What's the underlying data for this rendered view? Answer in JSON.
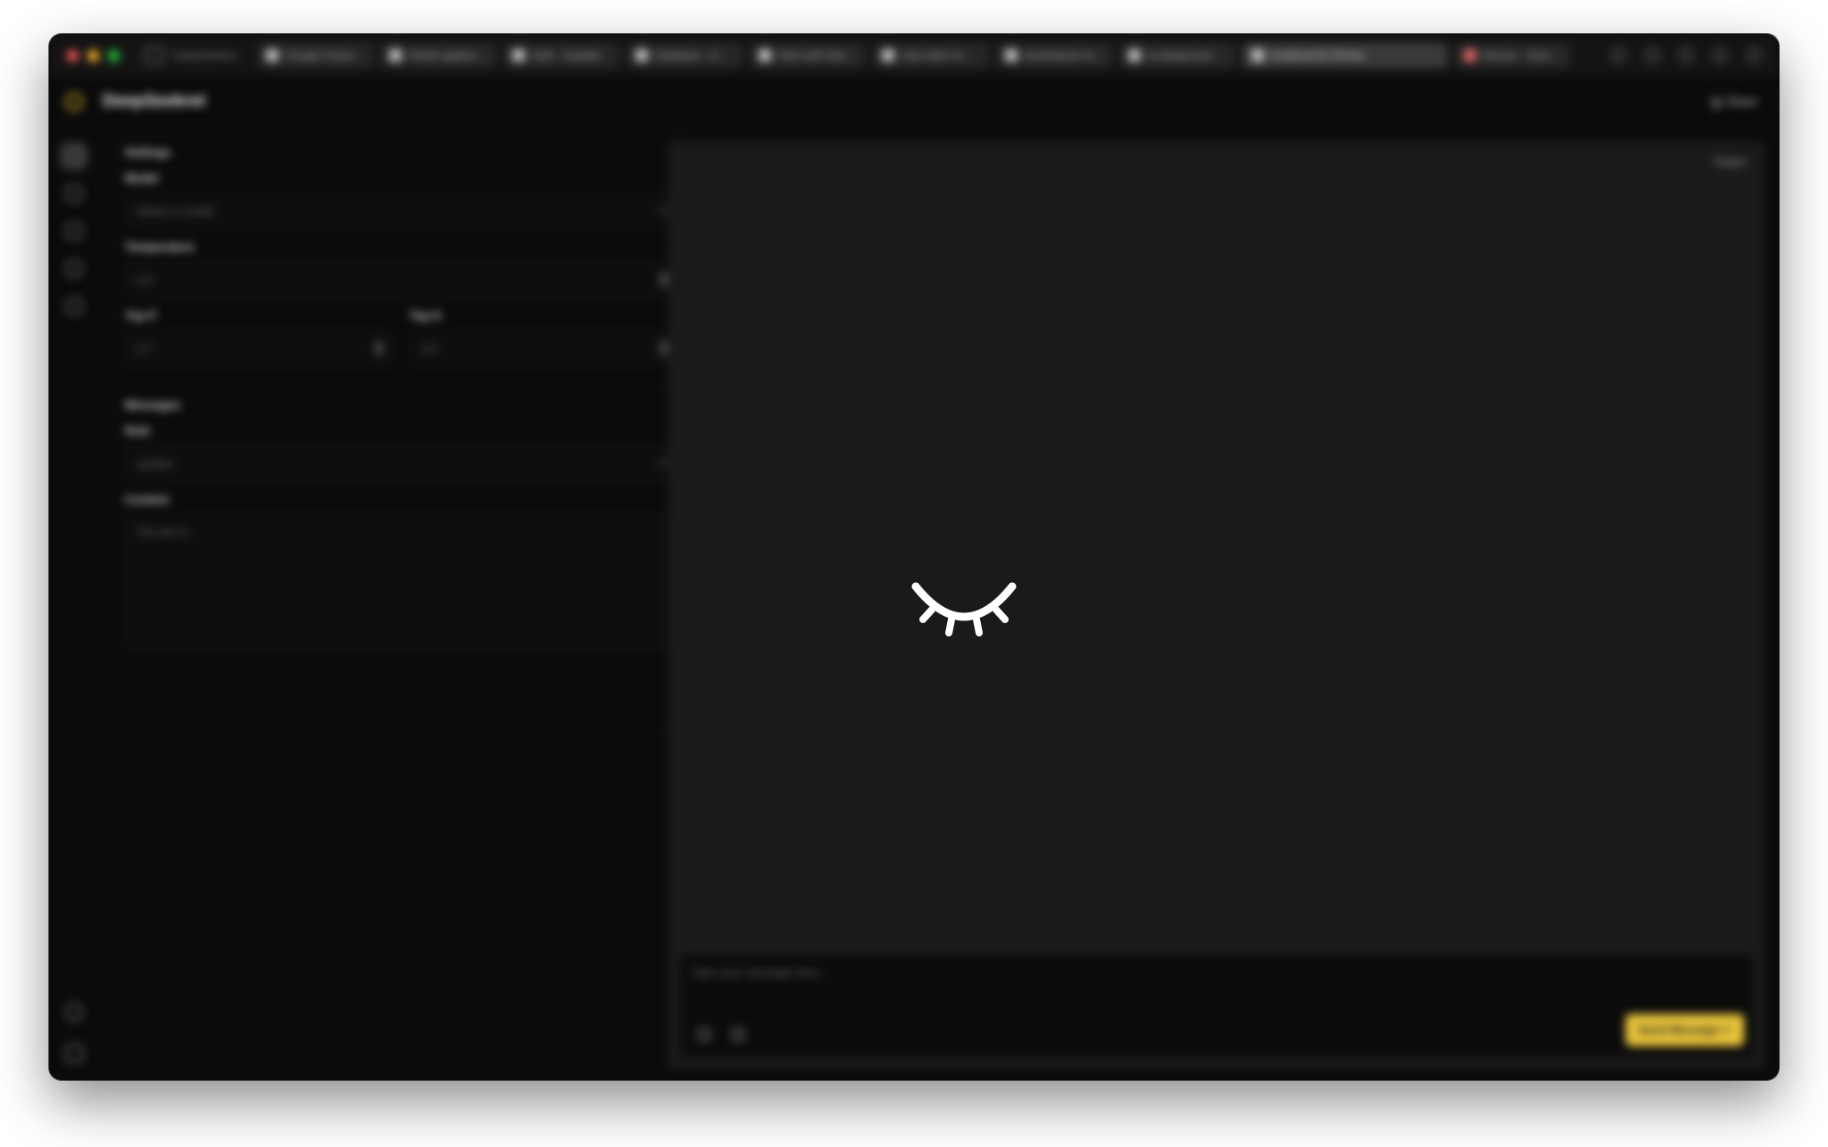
{
  "browser": {
    "workspace": "DeepSeekret",
    "tabs": [
      {
        "label": "Google Cloud...",
        "active": false
      },
      {
        "label": "OAuth applica...",
        "active": false
      },
      {
        "label": "Auth - Supaba",
        "active": false
      },
      {
        "label": "Database - A...",
        "active": false
      },
      {
        "label": "Start with Dee...",
        "active": false
      },
      {
        "label": "chat sdom ai...",
        "active": false
      },
      {
        "label": "basehepost ve...",
        "active": false
      },
      {
        "label": "ai playground",
        "active": false
      },
      {
        "label": "localhost:5173/chat",
        "active": true
      },
      {
        "label": "Barsen - Sess...",
        "active": false
      }
    ]
  },
  "app": {
    "title": "DeepSeekret",
    "share_label": "Share"
  },
  "settings": {
    "title": "Settings",
    "model_label": "Model",
    "model_placeholder": "Select a model",
    "temperature_label": "Temperature",
    "temperature_value": "0.4",
    "top_p_label": "Top P",
    "top_p_value": "0.7",
    "top_k_label": "Top K",
    "top_k_value": "0.0"
  },
  "messages": {
    "title": "Messages",
    "role_label": "Role",
    "role_value": "system",
    "content_label": "Content",
    "content_placeholder": "You are a..."
  },
  "output": {
    "label": "Output",
    "input_placeholder": "Type your message here...",
    "send_label": "Send Message ↵"
  },
  "colors": {
    "accent": "#e8c33a",
    "background": "#0b0b0b",
    "output_bg": "#1a1a1a"
  },
  "overlay_icon": "closed-eye-icon"
}
